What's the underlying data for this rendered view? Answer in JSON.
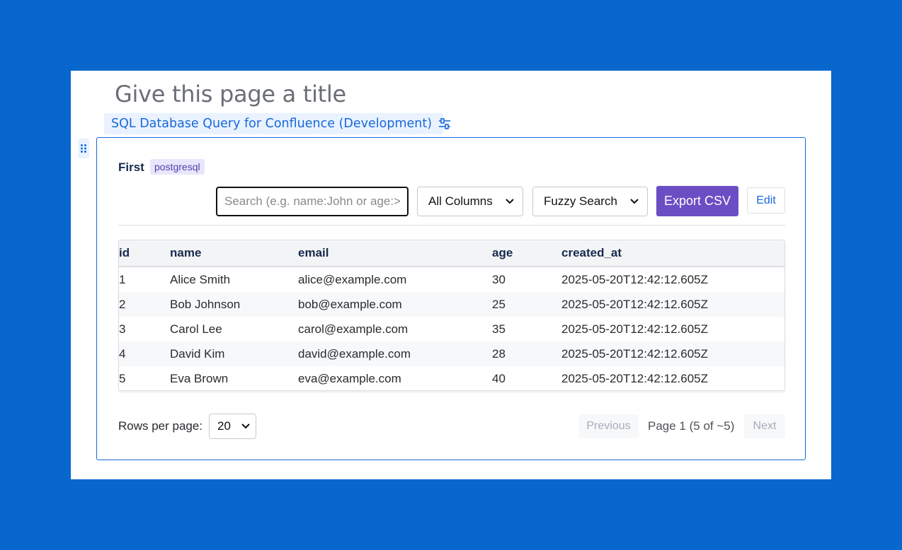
{
  "page": {
    "title_placeholder": "Give this page a title"
  },
  "macro": {
    "label": "SQL Database Query for Confluence (Development)",
    "settings_icon": "sliders-icon",
    "drag_icon": "drag-handle-icon"
  },
  "connection": {
    "name": "First",
    "type_badge": "postgresql"
  },
  "toolbar": {
    "search_placeholder": "Search (e.g. name:John or age:>30)",
    "search_value": "",
    "column_filter": "All Columns",
    "search_mode": "Fuzzy Search",
    "export_label": "Export CSV",
    "edit_label": "Edit"
  },
  "table": {
    "columns": [
      "id",
      "name",
      "email",
      "age",
      "created_at"
    ],
    "rows": [
      [
        "1",
        "Alice Smith",
        "alice@example.com",
        "30",
        "2025-05-20T12:42:12.605Z"
      ],
      [
        "2",
        "Bob Johnson",
        "bob@example.com",
        "25",
        "2025-05-20T12:42:12.605Z"
      ],
      [
        "3",
        "Carol Lee",
        "carol@example.com",
        "35",
        "2025-05-20T12:42:12.605Z"
      ],
      [
        "4",
        "David Kim",
        "david@example.com",
        "28",
        "2025-05-20T12:42:12.605Z"
      ],
      [
        "5",
        "Eva Brown",
        "eva@example.com",
        "40",
        "2025-05-20T12:42:12.605Z"
      ]
    ]
  },
  "pagination": {
    "rows_per_page_label": "Rows per page:",
    "rows_per_page_value": "20",
    "previous_label": "Previous",
    "page_info": "Page 1 (5 of ~5)",
    "next_label": "Next"
  },
  "colors": {
    "background": "#0767cc",
    "accent": "#1868db",
    "export_button": "#6b4ec4"
  }
}
